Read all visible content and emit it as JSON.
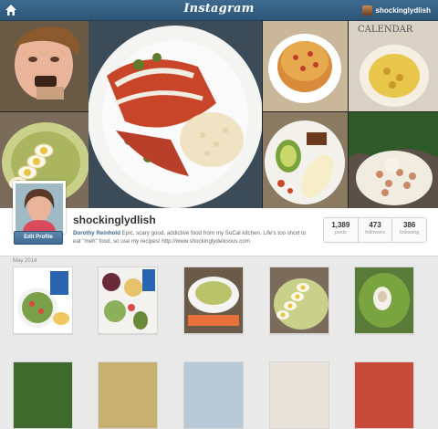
{
  "header": {
    "logo_text": "Instagram",
    "username": "shockinglydlish",
    "home_icon": "home-icon",
    "bar_color": "#3d6a8f"
  },
  "profile": {
    "handle": "shockinglydlish",
    "display_name": "Dorothy Reinhold",
    "bio": "Epic, scary good, addictive food from my SoCal kitchen. Life's too short to eat \"meh\" food, so use my recipes! http://www.shockinglydelicious.com",
    "edit_button": "Edit Profile",
    "stats": [
      {
        "count": "1,389",
        "label": "posts"
      },
      {
        "count": "473",
        "label": "followers"
      },
      {
        "count": "386",
        "label": "following"
      }
    ]
  },
  "feed": {
    "month_label": "May 2014"
  },
  "banner_tiles": [
    "boy-eating-photo",
    "enchiladas-photo",
    "stacked-tostada-photo",
    "calendar-pasta-photo",
    "deviled-eggs-photo",
    "avocado-plate-photo",
    "greens-beans-photo"
  ]
}
